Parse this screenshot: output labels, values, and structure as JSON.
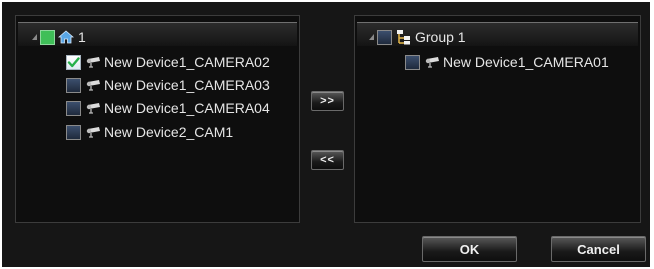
{
  "left_tree": {
    "root": {
      "label": "1",
      "checked": true,
      "icon": "home-icon"
    },
    "items": [
      {
        "label": "New Device1_CAMERA02",
        "checked": true,
        "icon": "camera-icon"
      },
      {
        "label": "New Device1_CAMERA03",
        "checked": false,
        "icon": "camera-icon"
      },
      {
        "label": "New Device1_CAMERA04",
        "checked": false,
        "icon": "camera-icon"
      },
      {
        "label": "New Device2_CAM1",
        "checked": false,
        "icon": "camera-icon"
      }
    ]
  },
  "right_tree": {
    "root": {
      "label": "Group 1",
      "checked": false,
      "icon": "group-icon"
    },
    "items": [
      {
        "label": "New Device1_CAMERA01",
        "checked": false,
        "icon": "camera-icon"
      }
    ]
  },
  "transfer": {
    "add_label": ">>",
    "remove_label": "<<"
  },
  "actions": {
    "ok_label": "OK",
    "cancel_label": "Cancel"
  },
  "colors": {
    "background": "#161616",
    "panel": "#0e0e0e",
    "check_green": "#3fbf58",
    "text": "#e6e6e6"
  }
}
